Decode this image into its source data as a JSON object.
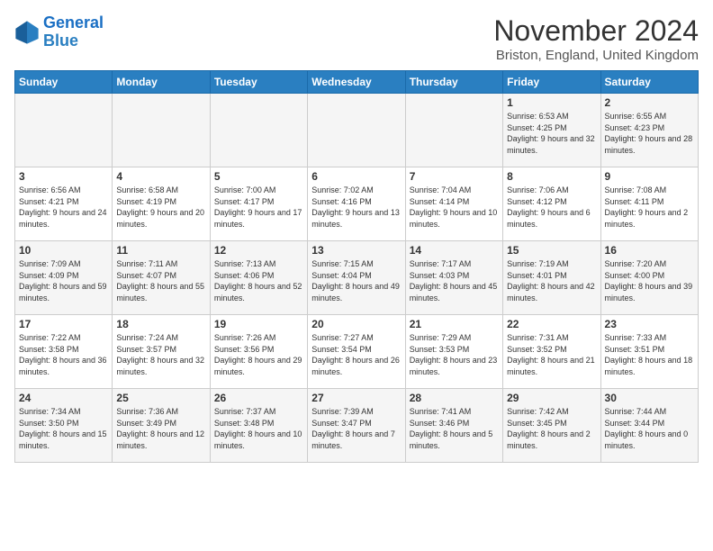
{
  "logo": {
    "line1": "General",
    "line2": "Blue"
  },
  "title": "November 2024",
  "location": "Briston, England, United Kingdom",
  "days_of_week": [
    "Sunday",
    "Monday",
    "Tuesday",
    "Wednesday",
    "Thursday",
    "Friday",
    "Saturday"
  ],
  "weeks": [
    [
      {
        "day": "",
        "sunrise": "",
        "sunset": "",
        "daylight": ""
      },
      {
        "day": "",
        "sunrise": "",
        "sunset": "",
        "daylight": ""
      },
      {
        "day": "",
        "sunrise": "",
        "sunset": "",
        "daylight": ""
      },
      {
        "day": "",
        "sunrise": "",
        "sunset": "",
        "daylight": ""
      },
      {
        "day": "",
        "sunrise": "",
        "sunset": "",
        "daylight": ""
      },
      {
        "day": "1",
        "sunrise": "Sunrise: 6:53 AM",
        "sunset": "Sunset: 4:25 PM",
        "daylight": "Daylight: 9 hours and 32 minutes."
      },
      {
        "day": "2",
        "sunrise": "Sunrise: 6:55 AM",
        "sunset": "Sunset: 4:23 PM",
        "daylight": "Daylight: 9 hours and 28 minutes."
      }
    ],
    [
      {
        "day": "3",
        "sunrise": "Sunrise: 6:56 AM",
        "sunset": "Sunset: 4:21 PM",
        "daylight": "Daylight: 9 hours and 24 minutes."
      },
      {
        "day": "4",
        "sunrise": "Sunrise: 6:58 AM",
        "sunset": "Sunset: 4:19 PM",
        "daylight": "Daylight: 9 hours and 20 minutes."
      },
      {
        "day": "5",
        "sunrise": "Sunrise: 7:00 AM",
        "sunset": "Sunset: 4:17 PM",
        "daylight": "Daylight: 9 hours and 17 minutes."
      },
      {
        "day": "6",
        "sunrise": "Sunrise: 7:02 AM",
        "sunset": "Sunset: 4:16 PM",
        "daylight": "Daylight: 9 hours and 13 minutes."
      },
      {
        "day": "7",
        "sunrise": "Sunrise: 7:04 AM",
        "sunset": "Sunset: 4:14 PM",
        "daylight": "Daylight: 9 hours and 10 minutes."
      },
      {
        "day": "8",
        "sunrise": "Sunrise: 7:06 AM",
        "sunset": "Sunset: 4:12 PM",
        "daylight": "Daylight: 9 hours and 6 minutes."
      },
      {
        "day": "9",
        "sunrise": "Sunrise: 7:08 AM",
        "sunset": "Sunset: 4:11 PM",
        "daylight": "Daylight: 9 hours and 2 minutes."
      }
    ],
    [
      {
        "day": "10",
        "sunrise": "Sunrise: 7:09 AM",
        "sunset": "Sunset: 4:09 PM",
        "daylight": "Daylight: 8 hours and 59 minutes."
      },
      {
        "day": "11",
        "sunrise": "Sunrise: 7:11 AM",
        "sunset": "Sunset: 4:07 PM",
        "daylight": "Daylight: 8 hours and 55 minutes."
      },
      {
        "day": "12",
        "sunrise": "Sunrise: 7:13 AM",
        "sunset": "Sunset: 4:06 PM",
        "daylight": "Daylight: 8 hours and 52 minutes."
      },
      {
        "day": "13",
        "sunrise": "Sunrise: 7:15 AM",
        "sunset": "Sunset: 4:04 PM",
        "daylight": "Daylight: 8 hours and 49 minutes."
      },
      {
        "day": "14",
        "sunrise": "Sunrise: 7:17 AM",
        "sunset": "Sunset: 4:03 PM",
        "daylight": "Daylight: 8 hours and 45 minutes."
      },
      {
        "day": "15",
        "sunrise": "Sunrise: 7:19 AM",
        "sunset": "Sunset: 4:01 PM",
        "daylight": "Daylight: 8 hours and 42 minutes."
      },
      {
        "day": "16",
        "sunrise": "Sunrise: 7:20 AM",
        "sunset": "Sunset: 4:00 PM",
        "daylight": "Daylight: 8 hours and 39 minutes."
      }
    ],
    [
      {
        "day": "17",
        "sunrise": "Sunrise: 7:22 AM",
        "sunset": "Sunset: 3:58 PM",
        "daylight": "Daylight: 8 hours and 36 minutes."
      },
      {
        "day": "18",
        "sunrise": "Sunrise: 7:24 AM",
        "sunset": "Sunset: 3:57 PM",
        "daylight": "Daylight: 8 hours and 32 minutes."
      },
      {
        "day": "19",
        "sunrise": "Sunrise: 7:26 AM",
        "sunset": "Sunset: 3:56 PM",
        "daylight": "Daylight: 8 hours and 29 minutes."
      },
      {
        "day": "20",
        "sunrise": "Sunrise: 7:27 AM",
        "sunset": "Sunset: 3:54 PM",
        "daylight": "Daylight: 8 hours and 26 minutes."
      },
      {
        "day": "21",
        "sunrise": "Sunrise: 7:29 AM",
        "sunset": "Sunset: 3:53 PM",
        "daylight": "Daylight: 8 hours and 23 minutes."
      },
      {
        "day": "22",
        "sunrise": "Sunrise: 7:31 AM",
        "sunset": "Sunset: 3:52 PM",
        "daylight": "Daylight: 8 hours and 21 minutes."
      },
      {
        "day": "23",
        "sunrise": "Sunrise: 7:33 AM",
        "sunset": "Sunset: 3:51 PM",
        "daylight": "Daylight: 8 hours and 18 minutes."
      }
    ],
    [
      {
        "day": "24",
        "sunrise": "Sunrise: 7:34 AM",
        "sunset": "Sunset: 3:50 PM",
        "daylight": "Daylight: 8 hours and 15 minutes."
      },
      {
        "day": "25",
        "sunrise": "Sunrise: 7:36 AM",
        "sunset": "Sunset: 3:49 PM",
        "daylight": "Daylight: 8 hours and 12 minutes."
      },
      {
        "day": "26",
        "sunrise": "Sunrise: 7:37 AM",
        "sunset": "Sunset: 3:48 PM",
        "daylight": "Daylight: 8 hours and 10 minutes."
      },
      {
        "day": "27",
        "sunrise": "Sunrise: 7:39 AM",
        "sunset": "Sunset: 3:47 PM",
        "daylight": "Daylight: 8 hours and 7 minutes."
      },
      {
        "day": "28",
        "sunrise": "Sunrise: 7:41 AM",
        "sunset": "Sunset: 3:46 PM",
        "daylight": "Daylight: 8 hours and 5 minutes."
      },
      {
        "day": "29",
        "sunrise": "Sunrise: 7:42 AM",
        "sunset": "Sunset: 3:45 PM",
        "daylight": "Daylight: 8 hours and 2 minutes."
      },
      {
        "day": "30",
        "sunrise": "Sunrise: 7:44 AM",
        "sunset": "Sunset: 3:44 PM",
        "daylight": "Daylight: 8 hours and 0 minutes."
      }
    ]
  ]
}
